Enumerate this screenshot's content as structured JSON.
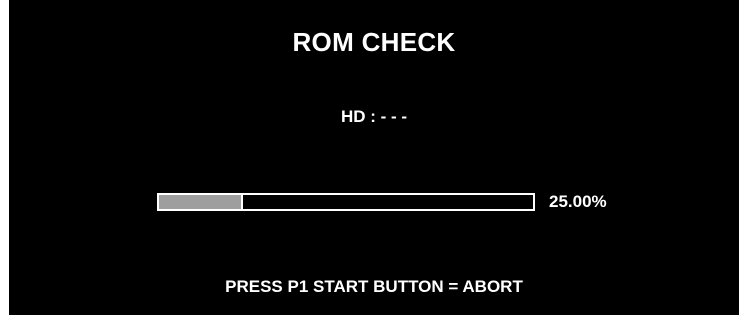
{
  "screen": {
    "title": "ROM CHECK",
    "hd_status": "HD : - - -",
    "progress": {
      "fraction": 0.2238,
      "label": "25.00%",
      "fill_color": "#9e9e9e"
    },
    "footer": "PRESS P1 START BUTTON = ABORT",
    "background_color": "#000000",
    "text_color": "#ffffff"
  }
}
